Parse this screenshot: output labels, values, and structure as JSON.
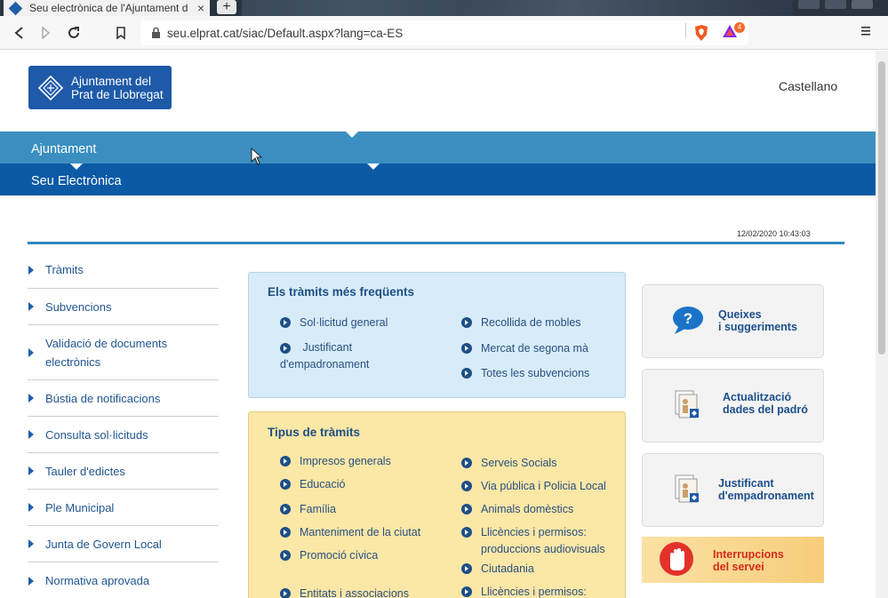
{
  "browser": {
    "tab_title": "Seu electrònica de l'Ajuntament d",
    "tab_close": "×",
    "new_tab": "+",
    "url": "seu.elprat.cat/siac/Default.aspx?lang=ca-ES",
    "bat_badge": "4"
  },
  "header": {
    "logo_line1": "Ajuntament del",
    "logo_line2": "Prat de Llobregat",
    "language_link": "Castellano"
  },
  "bands": {
    "primary": "Ajuntament",
    "secondary": "Seu Electrònica"
  },
  "datetime": "12/02/2020 10:43:03",
  "sidebar": {
    "items": [
      {
        "label": "Tràmits"
      },
      {
        "label": "Subvencions"
      },
      {
        "label": "Validació de documents electrònics"
      },
      {
        "label": "Bústia de notificacions"
      },
      {
        "label": "Consulta sol·licituds"
      },
      {
        "label": "Tauler d'edictes"
      },
      {
        "label": "Ple Municipal"
      },
      {
        "label": "Junta de Govern Local"
      },
      {
        "label": "Normativa aprovada"
      }
    ]
  },
  "frequent": {
    "title": "Els tràmits més freqüents",
    "left": [
      "Sol·licitud general",
      "Justificant d'empadronament"
    ],
    "right": [
      "Recollida de mobles",
      "Mercat de segona mà",
      "Totes les subvencions"
    ]
  },
  "types": {
    "title": "Tipus de tràmits",
    "left": [
      "Impresos generals",
      "Educació",
      "Família",
      "Manteniment de la ciutat",
      "Promoció cívica",
      "Entitats i associacions"
    ],
    "right": [
      "Serveis Socials",
      "Via pública i Policia Local",
      "Animals domèstics",
      "Llicències i permisos: produccions audiovisuals",
      "Ciutadania",
      "Llicències i permisos:"
    ]
  },
  "cards": {
    "complaints_line1": "Queixes",
    "complaints_line2": "i suggeriments",
    "padro_line1": "Actualització",
    "padro_line2": "dades del padró",
    "justificant_line1": "Justificant",
    "justificant_line2": "d'empadronament",
    "alert_line1": "Interrupcions",
    "alert_line2": "del servei"
  },
  "colors": {
    "band_primary": "#3a8fc0",
    "band_secondary": "#0c5aa6",
    "link": "#1f5590",
    "alert_red": "#d42a1a"
  }
}
